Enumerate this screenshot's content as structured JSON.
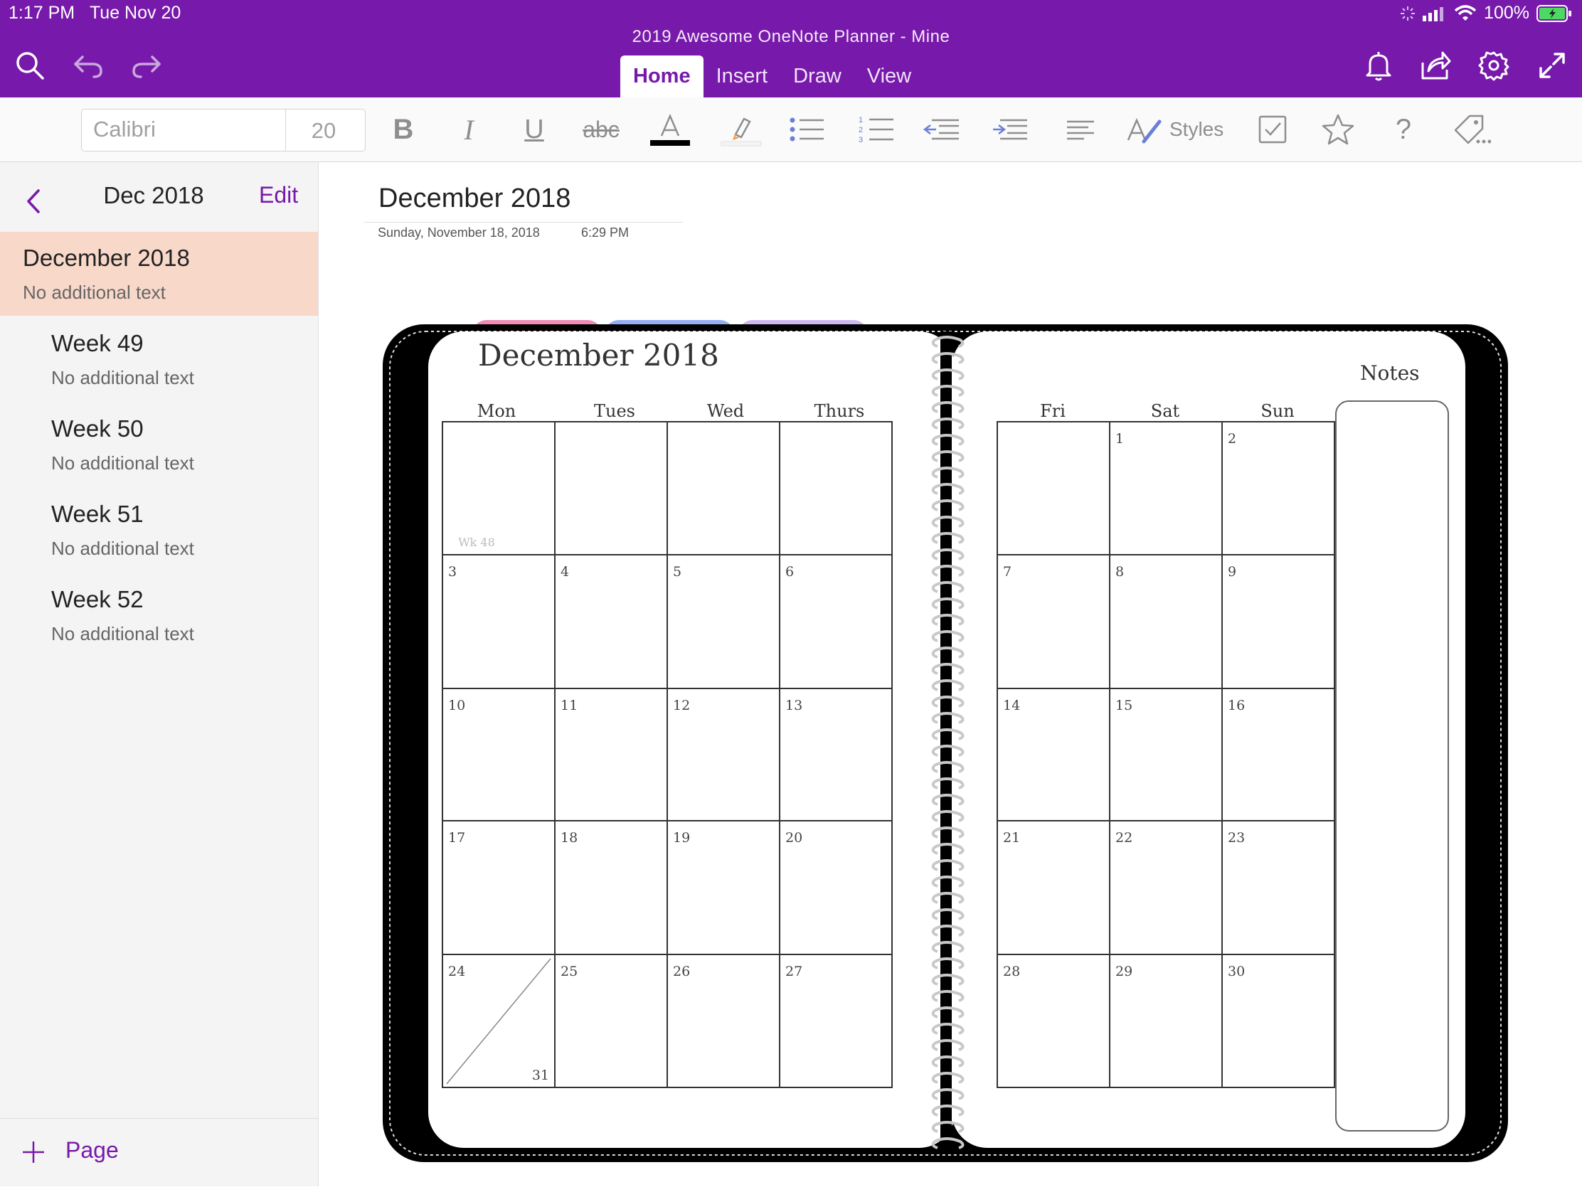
{
  "status_bar": {
    "time": "1:17 PM",
    "date": "Tue Nov 20",
    "battery": "100%"
  },
  "app": {
    "notebook_title": "2019 Awesome OneNote Planner - Mine",
    "accent_color": "#7719aa"
  },
  "tabs": [
    {
      "label": "Home",
      "active": true
    },
    {
      "label": "Insert",
      "active": false
    },
    {
      "label": "Draw",
      "active": false
    },
    {
      "label": "View",
      "active": false
    }
  ],
  "toolbar": {
    "font_name": "Calibri",
    "font_size": "20",
    "styles_label": "Styles"
  },
  "icons": {
    "top_left": [
      "search-icon",
      "undo-icon",
      "redo-icon"
    ],
    "top_right": [
      "bell-icon",
      "share-icon",
      "gear-icon",
      "expand-icon"
    ],
    "toolbar": [
      "bold-icon",
      "italic-icon",
      "underline-icon",
      "strikethrough-icon",
      "font-color-icon",
      "highlight-icon",
      "bullet-list-icon",
      "numbered-list-icon",
      "outdent-icon",
      "indent-icon",
      "align-icon",
      "styles-icon",
      "todo-checkbox-icon",
      "star-icon",
      "help-icon",
      "tag-icon"
    ]
  },
  "sidebar": {
    "section_title": "Dec 2018",
    "edit_label": "Edit",
    "add_page_label": "Page",
    "pages": [
      {
        "title": "December 2018",
        "subtitle": "No additional text",
        "selected": true,
        "level": 0
      },
      {
        "title": "Week 49",
        "subtitle": "No additional text",
        "selected": false,
        "level": 1
      },
      {
        "title": "Week 50",
        "subtitle": "No additional text",
        "selected": false,
        "level": 1
      },
      {
        "title": "Week 51",
        "subtitle": "No additional text",
        "selected": false,
        "level": 1
      },
      {
        "title": "Week 52",
        "subtitle": "No additional text",
        "selected": false,
        "level": 1
      }
    ]
  },
  "page": {
    "title": "December 2018",
    "date": "Sunday, November 18, 2018",
    "time": "6:29 PM"
  },
  "planner": {
    "heading": "December 2018",
    "notes_label": "Notes",
    "week_label": "Wk 48",
    "tab_colors": [
      "#f08bb5",
      "#94aef5",
      "#cdb8f2"
    ],
    "left_days": [
      "Mon",
      "Tues",
      "Wed",
      "Thurs"
    ],
    "right_days": [
      "Fri",
      "Sat",
      "Sun"
    ],
    "left_cells": [
      [
        "",
        "",
        "",
        ""
      ],
      [
        "3",
        "4",
        "5",
        "6"
      ],
      [
        "10",
        "11",
        "12",
        "13"
      ],
      [
        "17",
        "18",
        "19",
        "20"
      ],
      [
        "24",
        "25",
        "26",
        "27"
      ]
    ],
    "right_cells": [
      [
        "",
        "1",
        "2"
      ],
      [
        "7",
        "8",
        "9"
      ],
      [
        "14",
        "15",
        "16"
      ],
      [
        "21",
        "22",
        "23"
      ],
      [
        "28",
        "29",
        "30"
      ]
    ],
    "split_cell_second": "31"
  }
}
